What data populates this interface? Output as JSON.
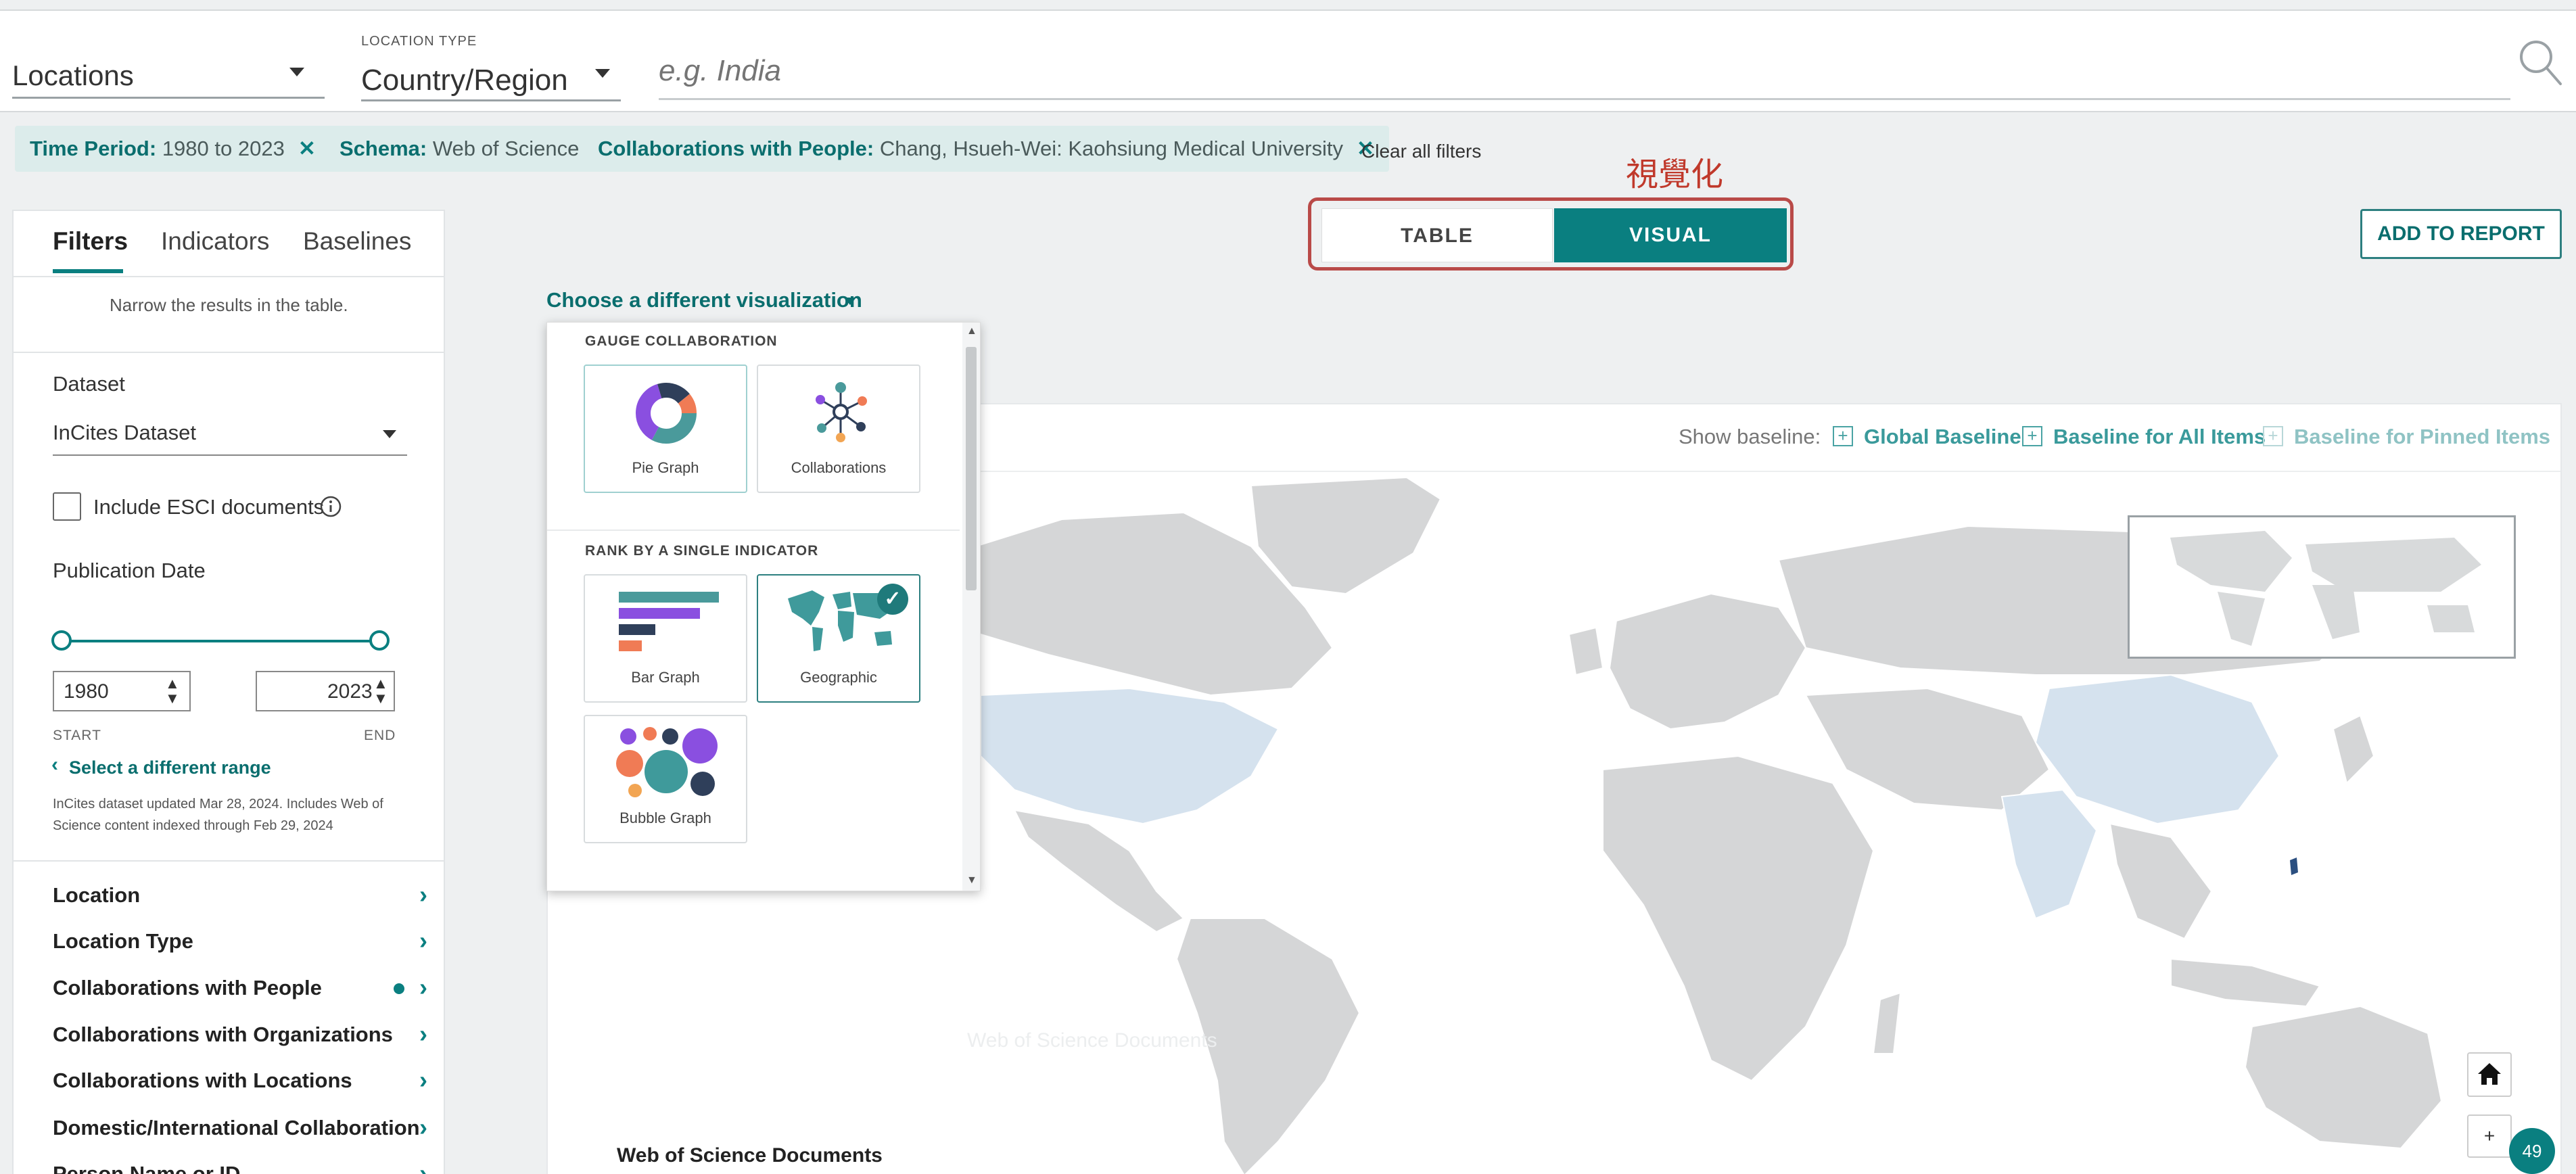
{
  "search": {
    "entity_value": "Locations",
    "location_type_label": "LOCATION TYPE",
    "location_type_value": "Country/Region",
    "placeholder": "e.g. India"
  },
  "chips": [
    {
      "key": "Time Period:",
      "value": " 1980 to 2023"
    },
    {
      "key": "Schema:",
      "value": " Web of Science"
    },
    {
      "key": "Collaborations with People:",
      "value": " Chang, Hsueh-Wei: Kaohsiung Medical University"
    }
  ],
  "chip_close": "✕",
  "clear_all": "Clear all filters",
  "annotation": "視覺化",
  "view_toggle": {
    "table": "TABLE",
    "visual": "VISUAL"
  },
  "add_to_report": "ADD TO REPORT",
  "sidebar": {
    "tabs": [
      "Filters",
      "Indicators",
      "Baselines"
    ],
    "hint": "Narrow the results in the table.",
    "dataset_label": "Dataset",
    "dataset_value": "InCites Dataset",
    "esci_label": "Include ESCI documents",
    "pubdate_label": "Publication Date",
    "start_year": "1980",
    "end_year": "2023",
    "start_label": "START",
    "end_label": "END",
    "range_link": "Select a different range",
    "update_note_1": "InCites dataset updated Mar 28, 2024. Includes Web of",
    "update_note_2": "Science content indexed through Feb 29, 2024",
    "facets": [
      "Location",
      "Location Type",
      "Collaborations with People",
      "Collaborations with Organizations",
      "Collaborations with Locations",
      "Domestic/International Collaboration",
      "Person Name or ID"
    ]
  },
  "viz": {
    "switch_link": "Choose a different visualization",
    "section1": "GAUGE COLLABORATION",
    "section2": "RANK BY A SINGLE INDICATOR",
    "cards": [
      "Pie Graph",
      "Collaborations",
      "Bar Graph",
      "Geographic",
      "Bubble Graph"
    ]
  },
  "baseline": {
    "label": "Show baseline:",
    "global": "Global Baseline",
    "all_items": "Baseline for All Items",
    "pinned": "Baseline for Pinned Items"
  },
  "map": {
    "legend_title": "Web of Science Documents",
    "faded_label": "Web of Science Documents",
    "zoom_in": "+",
    "badge": "49"
  },
  "colors": {
    "accent": "#0a7f80",
    "annotation_red": "#c0392b",
    "land": "#d5d6d7",
    "highlight_country": "#d5e2ee"
  }
}
